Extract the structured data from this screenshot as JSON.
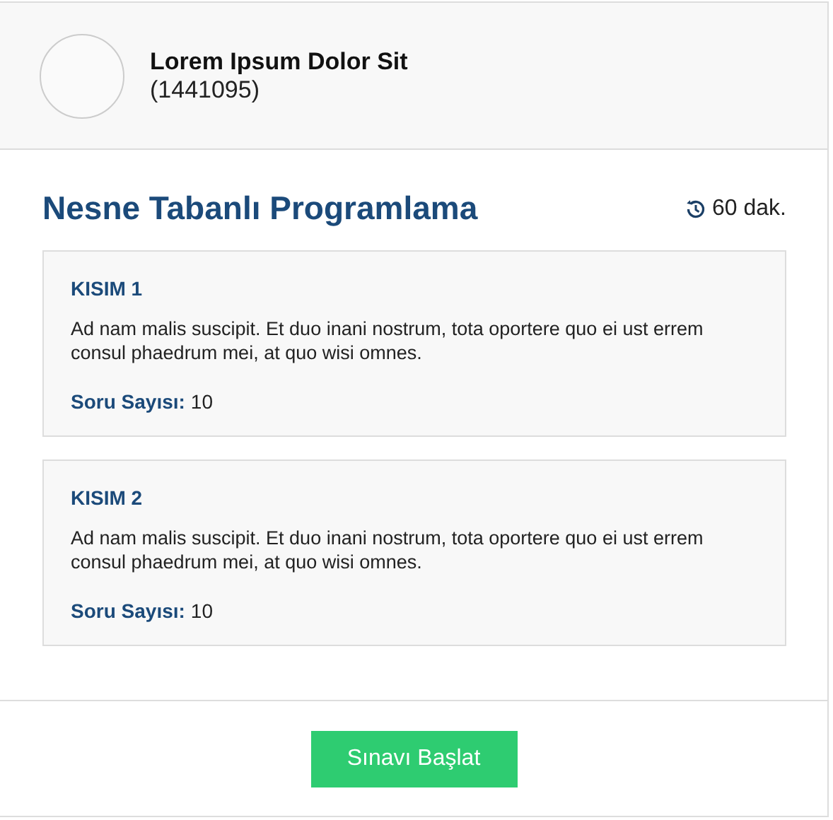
{
  "user": {
    "name": "Lorem Ipsum Dolor Sit",
    "id": "(1441095)"
  },
  "exam": {
    "title": "Nesne Tabanlı Programlama",
    "duration": "60 dak."
  },
  "sections": [
    {
      "title": "KISIM 1",
      "description": "Ad nam malis suscipit. Et duo inani nostrum, tota oportere quo ei ust errem consul phaedrum mei, at quo wisi omnes.",
      "count_label": "Soru Sayısı:",
      "count": "10"
    },
    {
      "title": "KISIM 2",
      "description": "Ad nam malis suscipit. Et duo inani nostrum, tota oportere quo ei ust errem consul phaedrum mei, at quo wisi omnes.",
      "count_label": "Soru Sayısı:",
      "count": "10"
    }
  ],
  "start_button": "Sınavı Başlat"
}
